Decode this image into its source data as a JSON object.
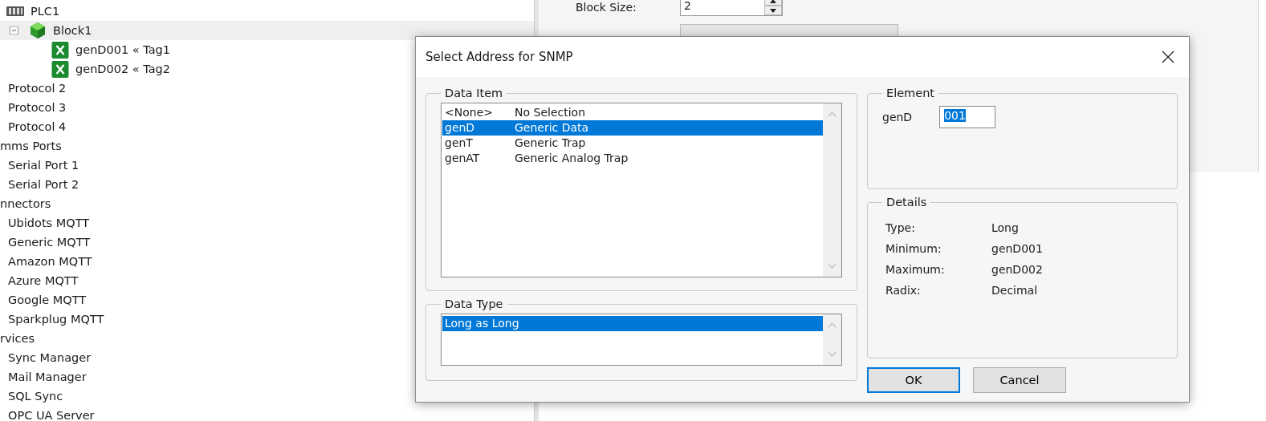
{
  "tree": [
    {
      "kind": "device",
      "label": "PLC1",
      "children": [
        {
          "kind": "block",
          "label": "Block1",
          "expanded": true,
          "selected": true,
          "children": [
            {
              "kind": "tag",
              "label": "genD001 « Tag1"
            },
            {
              "kind": "tag",
              "label": "genD002 « Tag2"
            }
          ]
        }
      ]
    },
    {
      "kind": "protocol",
      "label": "Protocol 2"
    },
    {
      "kind": "protocol",
      "label": "Protocol 3"
    },
    {
      "kind": "protocol",
      "label": "Protocol 4"
    },
    {
      "kind": "section",
      "label": "mms Ports",
      "children": [
        {
          "kind": "port",
          "label": "Serial Port 1"
        },
        {
          "kind": "port",
          "label": "Serial Port 2"
        }
      ]
    },
    {
      "kind": "section",
      "label": "nnectors",
      "children": [
        {
          "kind": "connector",
          "label": "Ubidots MQTT"
        },
        {
          "kind": "connector",
          "label": "Generic MQTT"
        },
        {
          "kind": "connector",
          "label": "Amazon MQTT"
        },
        {
          "kind": "connector",
          "label": "Azure MQTT"
        },
        {
          "kind": "connector",
          "label": "Google MQTT"
        },
        {
          "kind": "connector",
          "label": "Sparkplug MQTT"
        }
      ]
    },
    {
      "kind": "section",
      "label": "rvices",
      "children": [
        {
          "kind": "service",
          "label": "Sync Manager"
        },
        {
          "kind": "service",
          "label": "Mail Manager"
        },
        {
          "kind": "service",
          "label": "SQL Sync"
        },
        {
          "kind": "service",
          "label": "OPC UA Server"
        }
      ]
    }
  ],
  "properties": {
    "block_size": {
      "label": "Block Size:",
      "value": "2"
    }
  },
  "dialog": {
    "title": "Select Address for SNMP",
    "data_item": {
      "title": "Data Item",
      "items": [
        {
          "code": "<None>",
          "description": "No Selection",
          "selected": false
        },
        {
          "code": "genD",
          "description": "Generic Data",
          "selected": true
        },
        {
          "code": "genT",
          "description": "Generic Trap",
          "selected": false
        },
        {
          "code": "genAT",
          "description": "Generic Analog Trap",
          "selected": false
        }
      ]
    },
    "data_type": {
      "title": "Data Type",
      "items": [
        {
          "label": "Long as Long",
          "selected": true
        }
      ]
    },
    "element": {
      "title": "Element",
      "label": "genD",
      "value": "001",
      "value_selected": true
    },
    "details": {
      "title": "Details",
      "rows": [
        {
          "label": "Type:",
          "value": "Long"
        },
        {
          "label": "Minimum:",
          "value": "genD001"
        },
        {
          "label": "Maximum:",
          "value": "genD002"
        },
        {
          "label": "Radix:",
          "value": "Decimal"
        }
      ]
    },
    "buttons": [
      {
        "label": "OK",
        "default": true
      },
      {
        "label": "Cancel",
        "default": false
      }
    ]
  }
}
